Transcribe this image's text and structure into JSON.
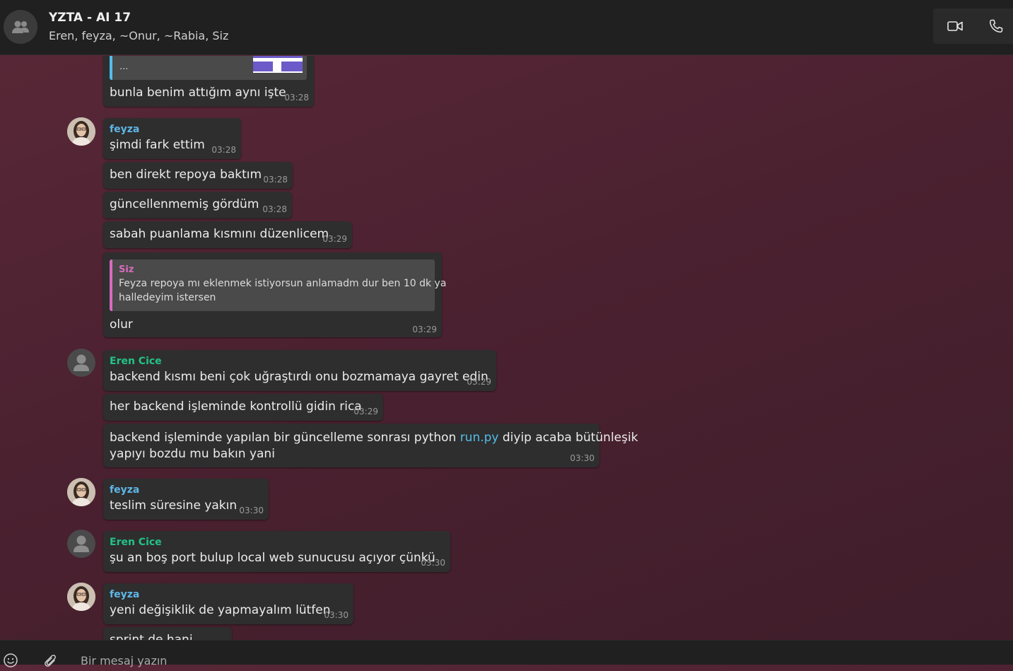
{
  "header": {
    "title": "YZTA - AI 17",
    "participants": "Eren, feyza, ~Onur, ~Rabia, Siz",
    "group_avatar_icon": "group-icon",
    "video_icon": "video-call-icon",
    "phone_icon": "phone-call-icon"
  },
  "messages": {
    "m0": {
      "quoted_text": "...",
      "text": "bunla benim attığım aynı işte",
      "time": "03:28"
    },
    "m1": {
      "sender": "feyza",
      "text": "şimdi fark ettim",
      "time": "03:28"
    },
    "m2": {
      "text": "ben direkt repoya baktım",
      "time": "03:28"
    },
    "m3": {
      "text": "güncellenmemiş gördüm",
      "time": "03:28"
    },
    "m4": {
      "text": "sabah puanlama kısmını düzenlicem",
      "time": "03:29"
    },
    "m5": {
      "quote_sender": "Siz",
      "quote_line1": "Feyza repoya mı eklenmek istiyorsun anlamadm dur ben 10 dk ya",
      "quote_line2": "halledeyim istersen",
      "text": "olur",
      "time": "03:29"
    },
    "m6": {
      "sender": "Eren Cice",
      "text": "backend kısmı beni çok uğraştırdı onu bozmamaya gayret edin",
      "time": "03:29"
    },
    "m7": {
      "text": "her backend işleminde kontrollü gidin rica",
      "time": "03:29"
    },
    "m8": {
      "text_before_link": "backend işleminde yapılan bir güncelleme sonrası python ",
      "link": "run.py",
      "text_after_link": " diyip acaba bütünleşik",
      "line2": "yapıyı bozdu mu bakın yani",
      "time": "03:30"
    },
    "m9": {
      "sender": "feyza",
      "text": "teslim süresine yakın",
      "time": "03:30"
    },
    "m10": {
      "sender": "Eren Cice",
      "text": "şu an boş port bulup local web sunucusu açıyor çünkü",
      "time": "03:30"
    },
    "m11": {
      "sender": "feyza",
      "text": "yeni değişiklik de yapmayalım lütfen",
      "time": "03:30"
    },
    "m12": {
      "text": "sprint de hani"
    }
  },
  "composer": {
    "placeholder": "Bir mesaj yazın",
    "emoji_icon": "emoji-icon",
    "attach_icon": "paperclip-icon"
  },
  "colors": {
    "feyza_name": "#5fb6e8",
    "eren_name": "#23c287",
    "quote_accent": "#d96bbd",
    "link": "#53bdeb",
    "bubble": "#2e2e2e"
  }
}
